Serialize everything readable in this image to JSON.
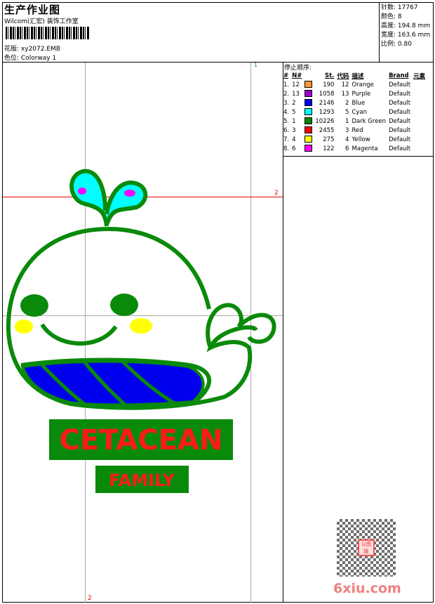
{
  "header": {
    "title": "生产作业图",
    "company": "Wilcom(汇宏) 装饰工作室",
    "design_label": "花版:",
    "design_value": "xy2072.EMB",
    "colorway_label": "色位:",
    "colorway_value": "Colorway 1"
  },
  "stats": [
    {
      "label": "针数:",
      "value": "17767"
    },
    {
      "label": "颜色:",
      "value": "8"
    },
    {
      "label": "高度:",
      "value": "194.8 mm"
    },
    {
      "label": "宽度:",
      "value": "163.6 mm"
    },
    {
      "label": "比例:",
      "value": "0.80"
    }
  ],
  "stop_sequence": {
    "title": "停止顺序:",
    "columns": [
      "#",
      "N#",
      "",
      "St.",
      "代码",
      "描述",
      "Brand",
      "元素"
    ],
    "rows": [
      {
        "idx": "1.",
        "n": "12",
        "color": "#ff9933",
        "st": "190",
        "code": "12",
        "desc": "Orange",
        "brand": "Default"
      },
      {
        "idx": "2.",
        "n": "13",
        "color": "#9900cc",
        "st": "1058",
        "code": "13",
        "desc": "Purple",
        "brand": "Default"
      },
      {
        "idx": "3.",
        "n": "2",
        "color": "#0000ff",
        "st": "2146",
        "code": "2",
        "desc": "Blue",
        "brand": "Default"
      },
      {
        "idx": "4.",
        "n": "5",
        "color": "#00ffff",
        "st": "1293",
        "code": "5",
        "desc": "Cyan",
        "brand": "Default"
      },
      {
        "idx": "5.",
        "n": "1",
        "color": "#008800",
        "st": "10226",
        "code": "1",
        "desc": "Dark Green",
        "brand": "Default"
      },
      {
        "idx": "6.",
        "n": "3",
        "color": "#ff0000",
        "st": "2455",
        "code": "3",
        "desc": "Red",
        "brand": "Default"
      },
      {
        "idx": "7.",
        "n": "4",
        "color": "#ffff00",
        "st": "275",
        "code": "4",
        "desc": "Yellow",
        "brand": "Default"
      },
      {
        "idx": "8.",
        "n": "6",
        "color": "#ff00ff",
        "st": "122",
        "code": "6",
        "desc": "Magenta",
        "brand": "Default"
      }
    ]
  },
  "design": {
    "text1": "CETACEAN",
    "text2": "FAMILY",
    "marker_top": "1",
    "marker_right": "2",
    "marker_bottom": "2"
  },
  "watermark": {
    "text": "6xiu.com",
    "stamp": "以图版"
  }
}
